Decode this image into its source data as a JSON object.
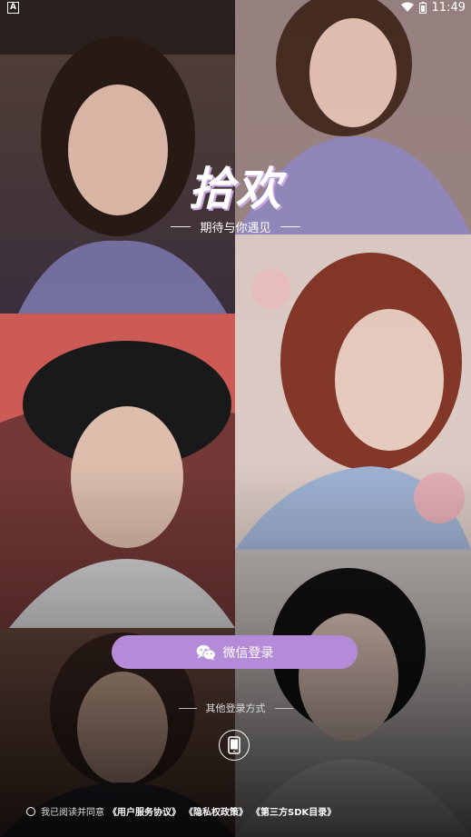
{
  "status_bar": {
    "notification_icon": "A",
    "time": "11:49",
    "icons": [
      "wifi-icon",
      "battery-icon"
    ]
  },
  "brand": {
    "title": "拾欢",
    "slogan": "期待与你遇见"
  },
  "login": {
    "wechat_button_label": "微信登录",
    "other_methods_label": "其他登录方式",
    "phone_login_icon": "phone-icon"
  },
  "agreement": {
    "prefix": "我已阅读并同意",
    "links": [
      "《用户服务协议》",
      "《隐私权政策》",
      "《第三方SDK目录》"
    ]
  },
  "colors": {
    "accent": "#b48bd8",
    "title_shadow": "#c9a6e2"
  }
}
